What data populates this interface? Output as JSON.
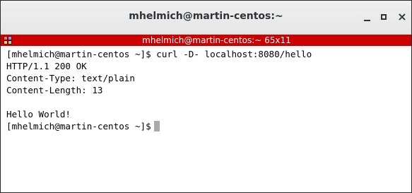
{
  "window": {
    "title": "mhelmich@martin-centos:~",
    "minimize_icon": "minimize-icon",
    "maximize_icon": "maximize-icon",
    "close_icon": "close-icon",
    "close_glyph": "×"
  },
  "terminal_header": {
    "title": "mhelmich@martin-centos:~ 65x11",
    "background_color": "#cc0000",
    "icon": "terminal-icon"
  },
  "terminal": {
    "lines": [
      "[mhelmich@martin-centos ~]$ curl -D- localhost:8080/hello",
      "HTTP/1.1 200 OK",
      "Content-Type: text/plain",
      "Content-Length: 13",
      "",
      "Hello World!"
    ],
    "prompt": "[mhelmich@martin-centos ~]$"
  }
}
